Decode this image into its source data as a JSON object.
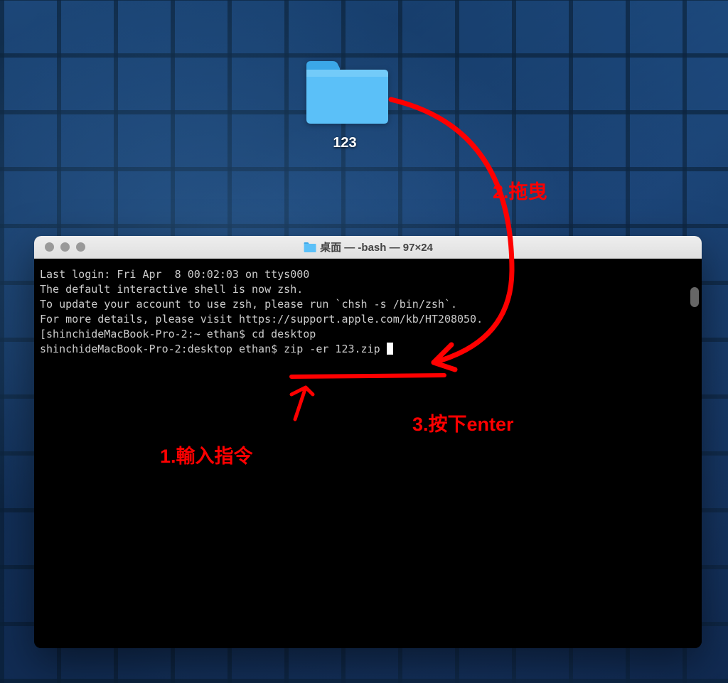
{
  "desktop": {
    "folder": {
      "name": "123"
    }
  },
  "terminal": {
    "title": "桌面 — -bash — 97×24",
    "lines": [
      "Last login: Fri Apr  8 00:02:03 on ttys000",
      "",
      "The default interactive shell is now zsh.",
      "To update your account to use zsh, please run `chsh -s /bin/zsh`.",
      "For more details, please visit https://support.apple.com/kb/HT208050.",
      "[shinchideMacBook-Pro-2:~ ethan$ cd desktop",
      "shinchideMacBook-Pro-2:desktop ethan$ zip -er 123.zip "
    ]
  },
  "annotations": {
    "step1": "1.輸入指令",
    "step2": "2.拖曳",
    "step3": "3.按下enter"
  }
}
